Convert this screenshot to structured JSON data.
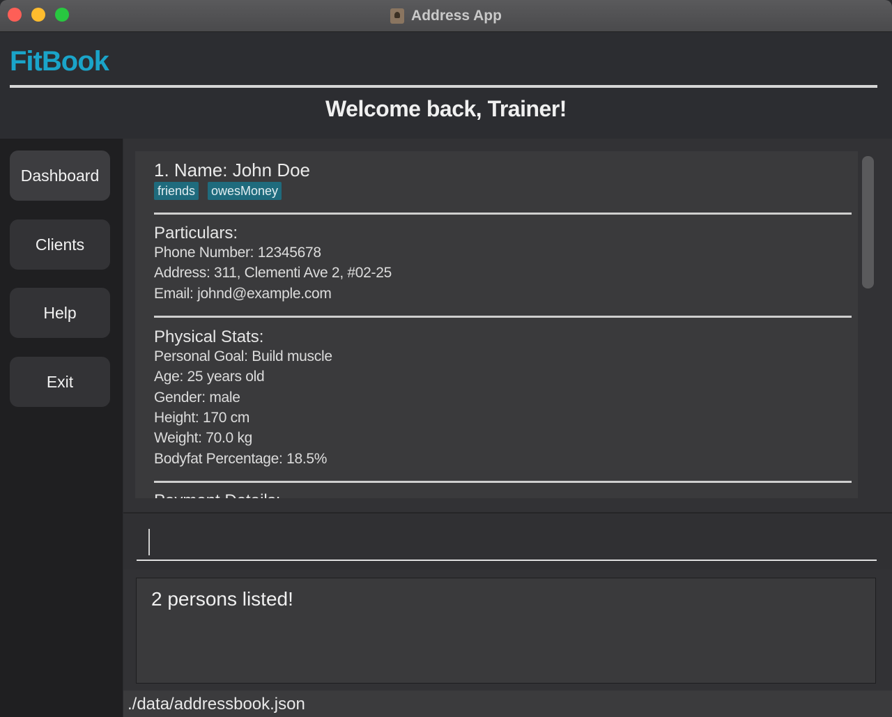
{
  "window": {
    "title": "Address App"
  },
  "header": {
    "brand": "FitBook",
    "welcome": "Welcome back, Trainer!"
  },
  "sidebar": {
    "items": [
      {
        "label": "Dashboard"
      },
      {
        "label": "Clients"
      },
      {
        "label": "Help"
      },
      {
        "label": "Exit"
      }
    ]
  },
  "person": {
    "name": "1. Name: John Doe",
    "tags": [
      "friends",
      "owesMoney"
    ],
    "particulars": {
      "title": "Particulars:",
      "phone": "Phone Number: 12345678",
      "address": "Address: 311, Clementi Ave 2, #02-25",
      "email": "Email: johnd@example.com"
    },
    "stats": {
      "title": "Physical Stats:",
      "goal": "Personal Goal: Build muscle",
      "age": "Age: 25 years old",
      "gender": "Gender: male",
      "height": "Height: 170 cm",
      "weight": "Weight: 70.0 kg",
      "bodyfat": "Bodyfat Percentage: 18.5%"
    },
    "next_section": "Payment Details:"
  },
  "command": {
    "value": "",
    "placeholder": ""
  },
  "result": {
    "text": "2 persons listed!"
  },
  "status": {
    "path": "./data/addressbook.json"
  },
  "colors": {
    "brand": "#1aa4c9",
    "tag": "#1f6b7d",
    "background": "#2a2b2e"
  }
}
